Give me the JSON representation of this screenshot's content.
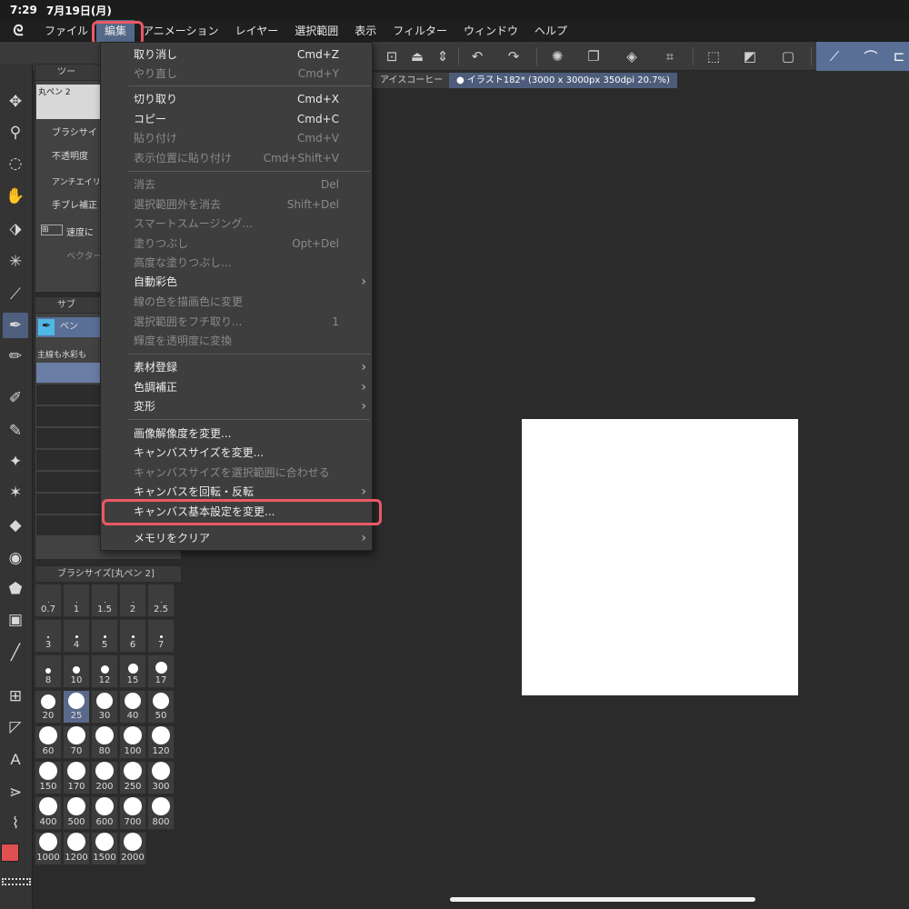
{
  "status": {
    "time": "7:29",
    "date": "7月19日(月)"
  },
  "menubar": {
    "items": [
      "ファイル",
      "編集",
      "アニメーション",
      "レイヤー",
      "選択範囲",
      "表示",
      "フィルター",
      "ウィンドウ",
      "ヘルプ"
    ],
    "active": "編集"
  },
  "tabs": {
    "first": "アイスコーヒー",
    "active": "イラスト182* (3000 x 3000px 350dpi 20.7%)"
  },
  "tool_property": {
    "header": "ツー",
    "brush_name": "丸ペン 2",
    "labels": [
      "ブラシサイ",
      "不透明度",
      "アンチエイリ",
      "手ブレ補正",
      "速度に",
      "ベクター"
    ]
  },
  "subtool": {
    "header": "サブ",
    "selected": "ペン",
    "group_label": "主線も水彩も"
  },
  "brush_size_panel": {
    "header": "ブラシサイズ[丸ペン 2]",
    "sizes": [
      "0.7",
      "1",
      "1.5",
      "2",
      "2.5",
      "3",
      "4",
      "5",
      "6",
      "7",
      "8",
      "10",
      "12",
      "15",
      "17",
      "20",
      "25",
      "30",
      "40",
      "50",
      "60",
      "70",
      "80",
      "100",
      "120",
      "150",
      "170",
      "200",
      "250",
      "300",
      "400",
      "500",
      "600",
      "700",
      "800",
      "1000",
      "1200",
      "1500",
      "2000"
    ],
    "selected": "25"
  },
  "edit_menu": {
    "items": [
      {
        "label": "取り消し",
        "shortcut": "Cmd+Z",
        "enabled": true
      },
      {
        "label": "やり直し",
        "shortcut": "Cmd+Y",
        "enabled": false
      },
      {
        "label": "切り取り",
        "shortcut": "Cmd+X",
        "enabled": true
      },
      {
        "label": "コピー",
        "shortcut": "Cmd+C",
        "enabled": true
      },
      {
        "label": "貼り付け",
        "shortcut": "Cmd+V",
        "enabled": false
      },
      {
        "label": "表示位置に貼り付け",
        "shortcut": "Cmd+Shift+V",
        "enabled": false
      },
      {
        "label": "消去",
        "shortcut": "Del",
        "enabled": false
      },
      {
        "label": "選択範囲外を消去",
        "shortcut": "Shift+Del",
        "enabled": false
      },
      {
        "label": "スマートスムージング...",
        "shortcut": "",
        "enabled": false
      },
      {
        "label": "塗りつぶし",
        "shortcut": "Opt+Del",
        "enabled": false
      },
      {
        "label": "高度な塗りつぶし...",
        "shortcut": "",
        "enabled": false
      },
      {
        "label": "自動彩色",
        "shortcut": "",
        "enabled": true,
        "submenu": true
      },
      {
        "label": "線の色を描画色に変更",
        "shortcut": "",
        "enabled": false
      },
      {
        "label": "選択範囲をフチ取り...",
        "shortcut": "1",
        "enabled": false
      },
      {
        "label": "輝度を透明度に変換",
        "shortcut": "",
        "enabled": false
      },
      {
        "label": "素材登録",
        "shortcut": "",
        "enabled": true,
        "submenu": true
      },
      {
        "label": "色調補正",
        "shortcut": "",
        "enabled": true,
        "submenu": true
      },
      {
        "label": "変形",
        "shortcut": "",
        "enabled": true,
        "submenu": true
      },
      {
        "label": "画像解像度を変更...",
        "shortcut": "",
        "enabled": true
      },
      {
        "label": "キャンバスサイズを変更...",
        "shortcut": "",
        "enabled": true
      },
      {
        "label": "キャンバスサイズを選択範囲に合わせる",
        "shortcut": "",
        "enabled": false
      },
      {
        "label": "キャンバスを回転・反転",
        "shortcut": "",
        "enabled": true,
        "submenu": true
      },
      {
        "label": "キャンバス基本設定を変更...",
        "shortcut": "",
        "enabled": true,
        "highlighted": true
      },
      {
        "label": "メモリをクリア",
        "shortcut": "",
        "enabled": true,
        "submenu": true
      }
    ]
  },
  "colors": {
    "highlight": "#ec5864",
    "main_color": "#e05050",
    "sub_color": "#4fb8e6",
    "accent": "#556a8a"
  },
  "icons": {
    "app": "clip-studio-icon",
    "tools": [
      "move-icon",
      "zoom-icon",
      "lasso-icon",
      "hand-icon",
      "select-icon",
      "magic-wand-icon",
      "eyedropper-icon",
      "pen-icon",
      "pencil-icon",
      "brush-icon",
      "airbrush-icon",
      "decoration-icon",
      "eraser-icon",
      "blend-icon",
      "fill-icon",
      "gradient-icon",
      "line-icon",
      "frame-icon",
      "ruler-icon",
      "text-icon",
      "balloon-icon",
      "correction-icon"
    ]
  }
}
